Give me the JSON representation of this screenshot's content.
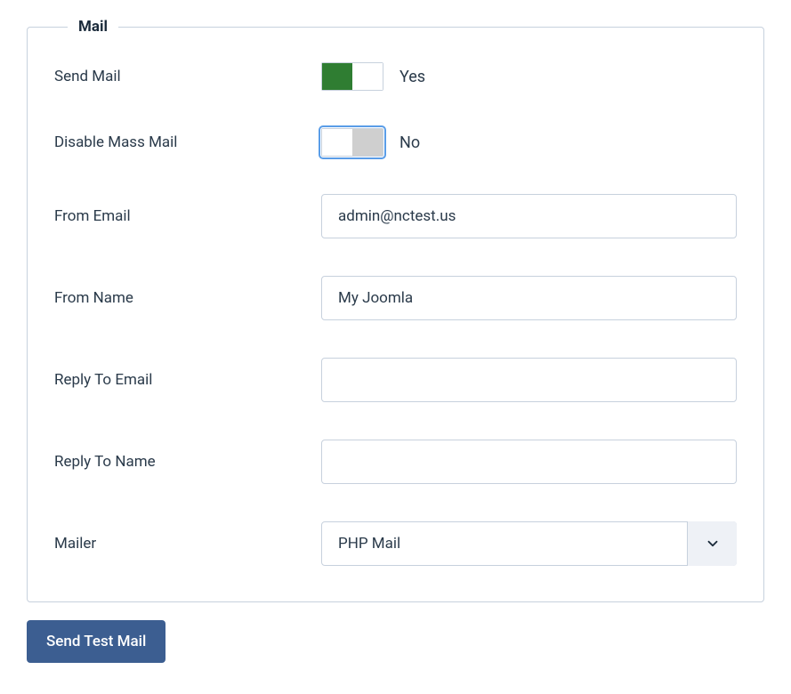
{
  "fieldset_title": "Mail",
  "send_mail": {
    "label": "Send Mail",
    "state_text": "Yes",
    "value": true
  },
  "disable_mass_mail": {
    "label": "Disable Mass Mail",
    "state_text": "No",
    "value": false
  },
  "from_email": {
    "label": "From Email",
    "value": "admin@nctest.us"
  },
  "from_name": {
    "label": "From Name",
    "value": "My Joomla"
  },
  "reply_to_email": {
    "label": "Reply To Email",
    "value": ""
  },
  "reply_to_name": {
    "label": "Reply To Name",
    "value": ""
  },
  "mailer": {
    "label": "Mailer",
    "selected": "PHP Mail"
  },
  "send_test_mail_button": "Send Test Mail"
}
